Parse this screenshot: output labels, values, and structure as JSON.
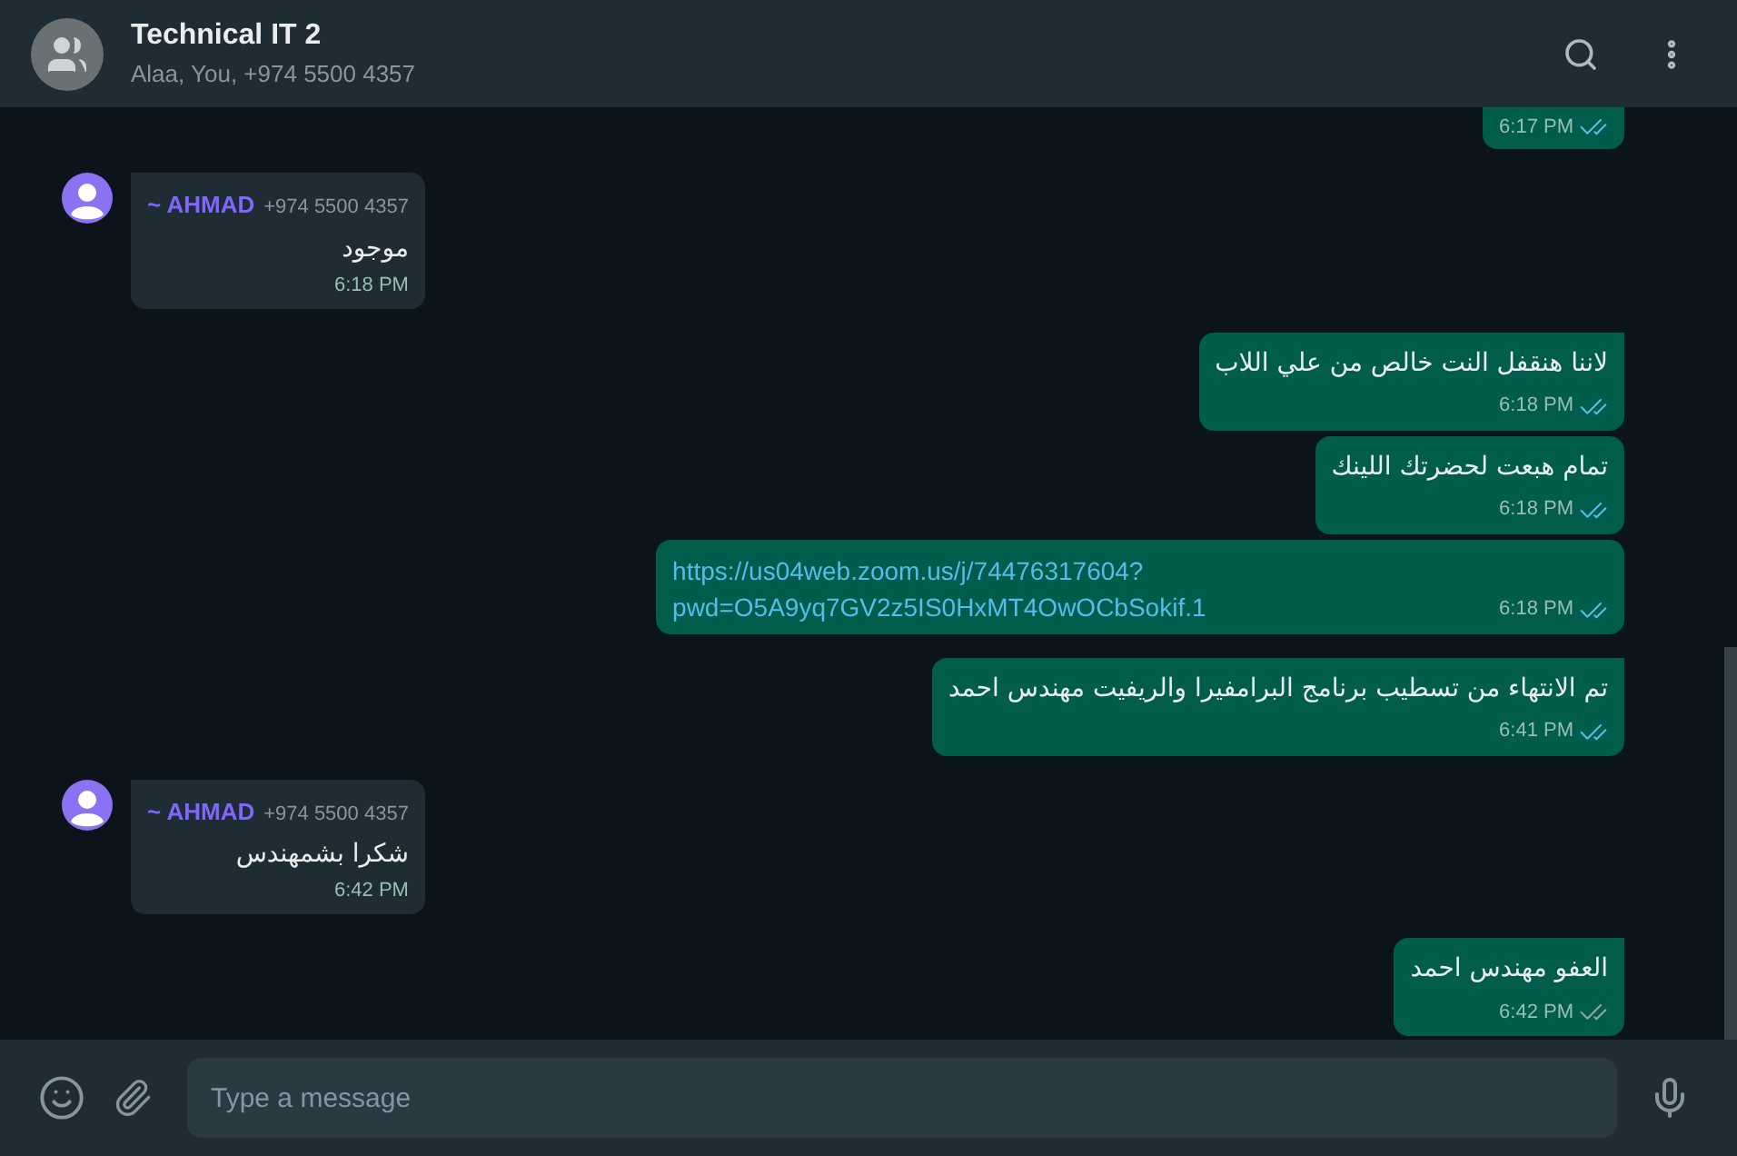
{
  "header": {
    "title": "Technical IT 2",
    "subtitle": "Alaa, You, +974 5500 4357"
  },
  "messages": [
    {
      "kind": "outgoing",
      "time": "6:17 PM",
      "read": true
    },
    {
      "kind": "incoming",
      "tail": true,
      "sender": "~ AHMAD",
      "phone": "+974 5500 4357",
      "text": "موجود",
      "time": "6:18 PM"
    },
    {
      "kind": "outgoing",
      "tail": true,
      "text": "لاننا هنقفل النت خالص من علي اللاب",
      "time": "6:18 PM",
      "read": true
    },
    {
      "kind": "outgoing",
      "tail": false,
      "text": "تمام هبعت لحضرتك اللينك",
      "time": "6:18 PM",
      "read": true
    },
    {
      "kind": "link",
      "tail": false,
      "text": "https://us04web.zoom.us/j/74476317604?pwd=O5A9yq7GV2z5IS0HxMT4OwOCbSokif.1",
      "time": "6:18 PM",
      "read": true
    },
    {
      "kind": "outgoing",
      "tail": true,
      "text": "تم الانتهاء من تسطيب برنامج البرامفيرا والريفيت مهندس احمد",
      "time": "6:41 PM",
      "read": true
    },
    {
      "kind": "incoming",
      "tail": true,
      "sender": "~ AHMAD",
      "phone": "+974 5500 4357",
      "text": "شكرا بشمهندس",
      "time": "6:42 PM"
    },
    {
      "kind": "outgoing",
      "tail": true,
      "text": "العفو مهندس احمد",
      "time": "6:42 PM",
      "read": false
    }
  ],
  "composer": {
    "placeholder": "Type a message"
  }
}
